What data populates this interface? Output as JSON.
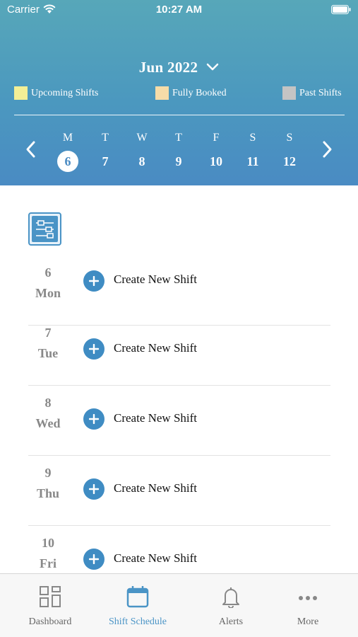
{
  "status_bar": {
    "carrier": "Carrier",
    "time": "10:27 AM"
  },
  "header": {
    "month_label": "Jun 2022",
    "legend": [
      {
        "label": "Upcoming Shifts",
        "color": "#f3ef96"
      },
      {
        "label": "Fully Booked",
        "color": "#f6dca8"
      },
      {
        "label": "Past Shifts",
        "color": "#c4c4c4"
      }
    ],
    "week": [
      {
        "letter": "M",
        "num": "6",
        "selected": true
      },
      {
        "letter": "T",
        "num": "7"
      },
      {
        "letter": "W",
        "num": "8"
      },
      {
        "letter": "T",
        "num": "9"
      },
      {
        "letter": "F",
        "num": "10"
      },
      {
        "letter": "S",
        "num": "11"
      },
      {
        "letter": "S",
        "num": "12"
      }
    ]
  },
  "shifts": [
    {
      "day": "6",
      "weekday": "Mon",
      "action": "Create New Shift"
    },
    {
      "day": "7",
      "weekday": "Tue",
      "action": "Create New Shift"
    },
    {
      "day": "8",
      "weekday": "Wed",
      "action": "Create New Shift"
    },
    {
      "day": "9",
      "weekday": "Thu",
      "action": "Create New Shift"
    },
    {
      "day": "10",
      "weekday": "Fri",
      "action": "Create New Shift"
    }
  ],
  "tabs": [
    {
      "label": "Dashboard",
      "icon": "dashboard-icon"
    },
    {
      "label": "Shift Schedule",
      "icon": "calendar-icon",
      "active": true
    },
    {
      "label": "Alerts",
      "icon": "bell-icon"
    },
    {
      "label": "More",
      "icon": "more-icon"
    }
  ],
  "colors": {
    "accent": "#4a94c6",
    "header_top": "#57a7b9",
    "header_bottom": "#4a8bc3"
  }
}
